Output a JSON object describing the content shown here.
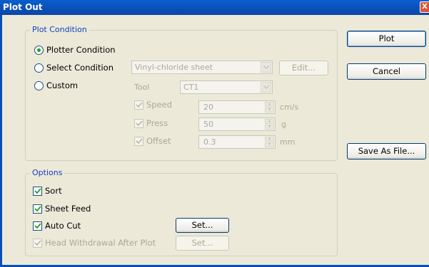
{
  "window": {
    "title": "Plot Out",
    "close_glyph": "X"
  },
  "plot_condition": {
    "title": "Plot Condition",
    "radios": [
      {
        "label": "Plotter Condition",
        "selected": true
      },
      {
        "label": "Select Condition",
        "selected": false
      },
      {
        "label": "Custom",
        "selected": false
      }
    ],
    "material_select": "Vinyl-chloride sheet",
    "edit_button": "Edit...",
    "tool_label": "Tool",
    "tool_select": "CT1",
    "speed": {
      "label": "Speed",
      "value": "20",
      "unit": "cm/s",
      "checked": true
    },
    "press": {
      "label": "Press",
      "value": "50",
      "unit": "g",
      "checked": true
    },
    "offset": {
      "label": "Offset",
      "value": "0.3",
      "unit": "mm",
      "checked": true
    }
  },
  "options": {
    "title": "Options",
    "sort": {
      "label": "Sort",
      "checked": true
    },
    "sheet_feed": {
      "label": "Sheet Feed",
      "checked": true
    },
    "auto_cut": {
      "label": "Auto Cut",
      "checked": true,
      "button": "Set..."
    },
    "head_withdrawal": {
      "label": "Head Withdrawal After Plot",
      "checked": true,
      "button": "Set..."
    }
  },
  "buttons": {
    "plot": "Plot",
    "cancel": "Cancel",
    "save_as_file": "Save As File..."
  }
}
